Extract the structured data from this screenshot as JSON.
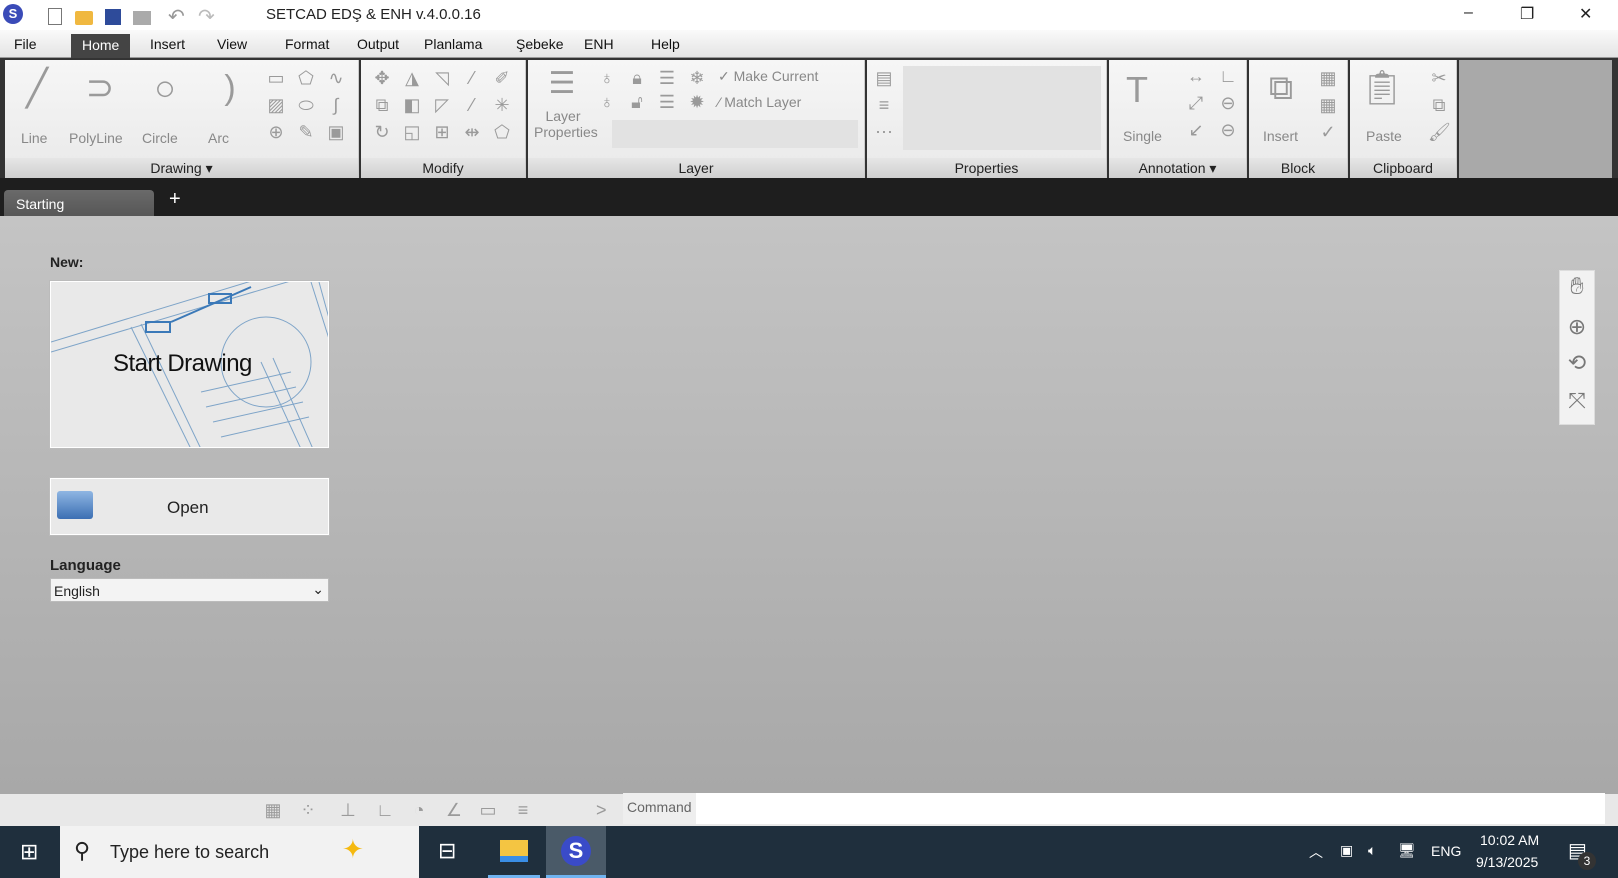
{
  "app": {
    "title": "SETCAD EDŞ & ENH v.4.0.0.16"
  },
  "window_controls": {
    "minimize": "–",
    "restore": "❐",
    "close": "✕"
  },
  "menu": [
    "File",
    "Home",
    "Insert",
    "View",
    "Format",
    "Output",
    "Planlama",
    "Şebeke",
    "ENH",
    "Help"
  ],
  "ribbon": {
    "drawing": {
      "label": "Drawing",
      "tools": [
        "Line",
        "PolyLine",
        "Circle",
        "Arc"
      ]
    },
    "modify": {
      "label": "Modify"
    },
    "layer": {
      "label": "Layer",
      "properties": "Layer Properties",
      "make_current": "Make Current",
      "match_layer": "Match Layer"
    },
    "properties": {
      "label": "Properties"
    },
    "annotation": {
      "label": "Annotation",
      "single": "Single"
    },
    "block": {
      "label": "Block",
      "insert": "Insert"
    },
    "clipboard": {
      "label": "Clipboard",
      "paste": "Paste"
    }
  },
  "tabs": {
    "active": "Starting",
    "add": "+"
  },
  "start": {
    "new_label": "New:",
    "start_drawing": "Start Drawing",
    "open": "Open",
    "language_label": "Language",
    "language_value": "English"
  },
  "command": {
    "placeholder": "Command",
    "prompt": ">"
  },
  "taskbar": {
    "search_placeholder": "Type here to search",
    "lang": "ENG",
    "time": "10:02 AM",
    "date": "9/13/2025",
    "notifications": "3"
  }
}
